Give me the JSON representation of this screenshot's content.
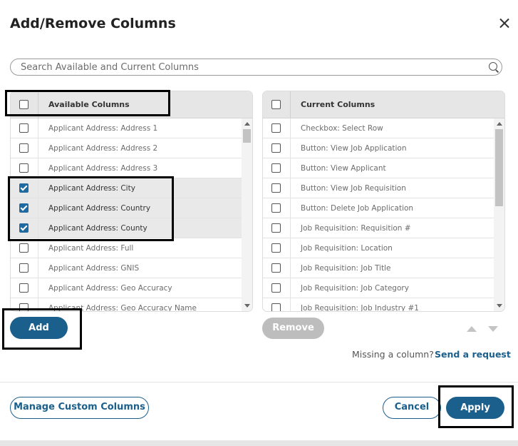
{
  "dialog": {
    "title": "Add/Remove Columns",
    "close_icon": "close-icon"
  },
  "search": {
    "placeholder": "Search Available and Current Columns",
    "value": "",
    "icon": "search-icon"
  },
  "available": {
    "header": "Available Columns",
    "rows": [
      {
        "label": "Applicant Address: Address 1",
        "checked": false
      },
      {
        "label": "Applicant Address: Address 2",
        "checked": false
      },
      {
        "label": "Applicant Address: Address 3",
        "checked": false
      },
      {
        "label": "Applicant Address: City",
        "checked": true
      },
      {
        "label": "Applicant Address: Country",
        "checked": true
      },
      {
        "label": "Applicant Address: County",
        "checked": true
      },
      {
        "label": "Applicant Address: Full",
        "checked": false
      },
      {
        "label": "Applicant Address: GNIS",
        "checked": false
      },
      {
        "label": "Applicant Address: Geo Accuracy",
        "checked": false
      },
      {
        "label": "Applicant Address: Geo Accuracy Name",
        "checked": false
      }
    ]
  },
  "current": {
    "header": "Current Columns",
    "rows": [
      {
        "label": "Checkbox: Select Row",
        "checked": false
      },
      {
        "label": "Button: View Job Application",
        "checked": false
      },
      {
        "label": "Button: View Applicant",
        "checked": false
      },
      {
        "label": "Button: View Job Requisition",
        "checked": false
      },
      {
        "label": "Button: Delete Job Application",
        "checked": false
      },
      {
        "label": "Job Requisition: Requisition #",
        "checked": false
      },
      {
        "label": "Job Requisition: Location",
        "checked": false
      },
      {
        "label": "Job Requisition: Job Title",
        "checked": false
      },
      {
        "label": "Job Requisition: Job Category",
        "checked": false
      },
      {
        "label": "Job Requisition: Job Industry #1",
        "checked": false
      }
    ]
  },
  "buttons": {
    "add": "Add",
    "remove": "Remove",
    "manage_custom": "Manage Custom Columns",
    "cancel": "Cancel",
    "apply": "Apply"
  },
  "missing": {
    "text": "Missing a column?",
    "link": "Send a request"
  },
  "colors": {
    "primary": "#1b5f8c",
    "checkbox_checked": "#1f6aa0",
    "disabled": "#bdbdbd",
    "header_bg": "#e6e6e6"
  }
}
